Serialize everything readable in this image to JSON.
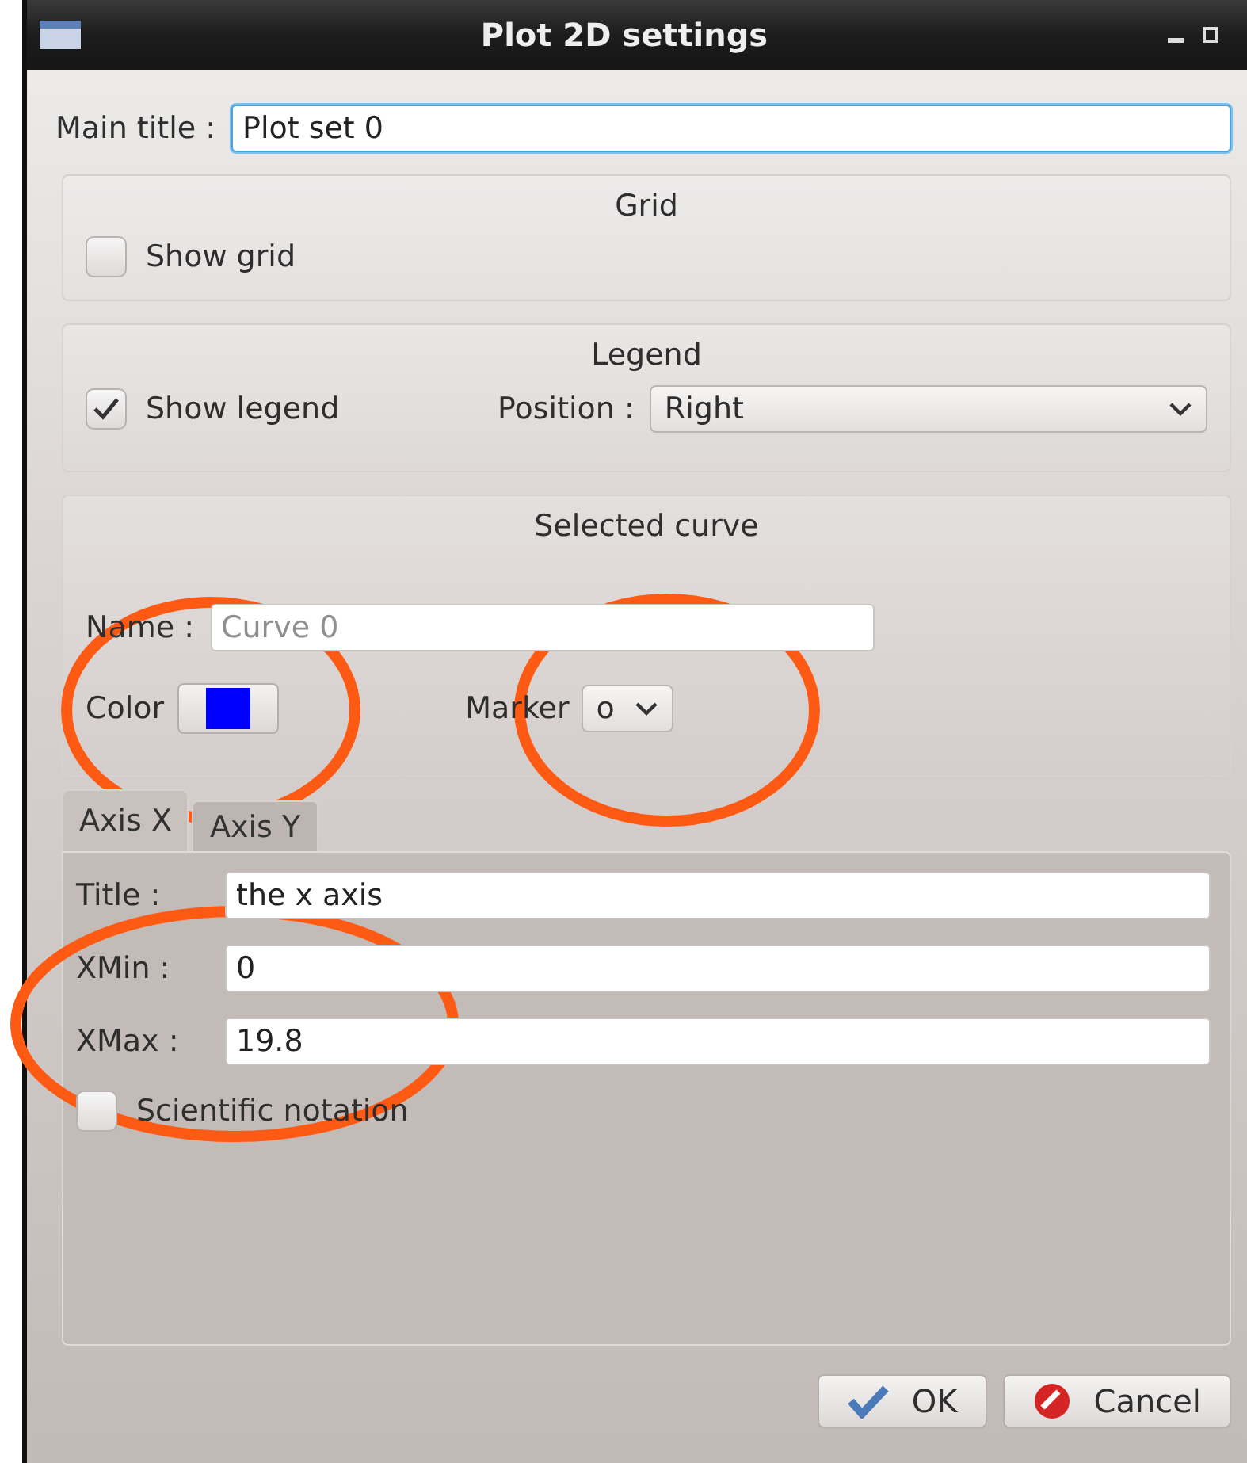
{
  "window": {
    "title": "Plot 2D settings"
  },
  "main_title": {
    "label": "Main title :",
    "value": "Plot set 0"
  },
  "grid": {
    "title": "Grid",
    "show_grid": {
      "label": "Show grid",
      "checked": false
    }
  },
  "legend": {
    "title": "Legend",
    "show_legend": {
      "label": "Show legend",
      "checked": true
    },
    "position": {
      "label": "Position :",
      "value": "Right"
    }
  },
  "selected_curve": {
    "title": "Selected curve",
    "name": {
      "label": "Name :",
      "placeholder": "Curve 0"
    },
    "color": {
      "label": "Color",
      "color": "#0000ff"
    },
    "marker": {
      "label": "Marker",
      "value": "o"
    }
  },
  "tabs": [
    {
      "label": "Axis X",
      "selected": true
    },
    {
      "label": "Axis Y",
      "selected": false
    }
  ],
  "axis": {
    "fields": [
      {
        "label": "Title :",
        "value": "the x axis"
      },
      {
        "label": "XMin :",
        "value": "0"
      },
      {
        "label": "XMax :",
        "value": "19.8"
      }
    ],
    "scientific_notation": {
      "label": "Scientific notation",
      "checked": false
    }
  },
  "buttons": [
    {
      "kind": "ok",
      "label": "OK"
    },
    {
      "kind": "cancel",
      "label": "Cancel"
    }
  ],
  "annotations": [
    {
      "kind": "color"
    },
    {
      "kind": "marker"
    },
    {
      "kind": "range"
    }
  ]
}
